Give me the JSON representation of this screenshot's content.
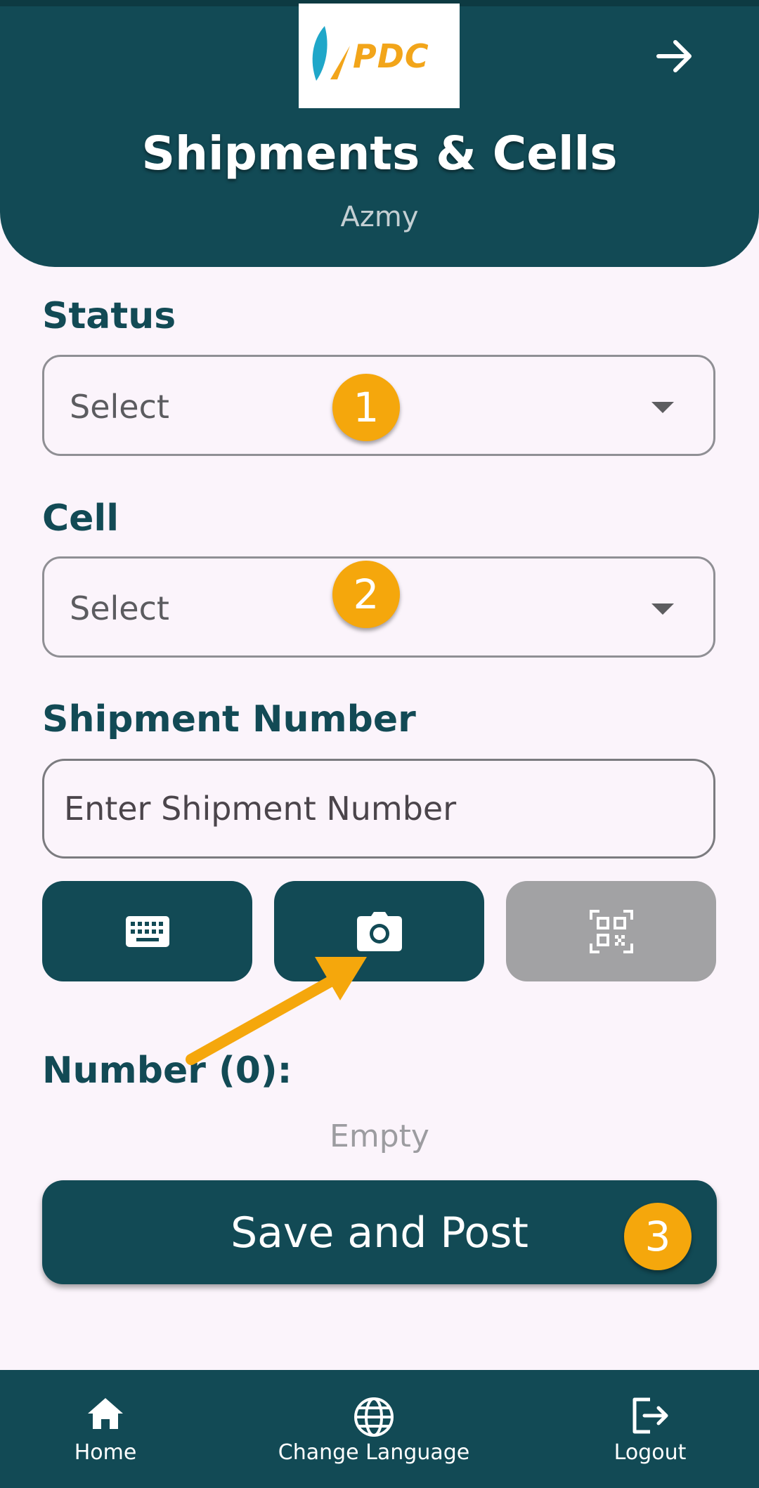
{
  "header": {
    "logo_text": "PDC",
    "title": "Shipments & Cells",
    "subtitle": "Azmy",
    "forward_icon": "arrow-right-icon"
  },
  "form": {
    "status_label": "Status",
    "status_value": "Select",
    "cell_label": "Cell",
    "cell_value": "Select",
    "shipment_label": "Shipment Number",
    "shipment_placeholder": "Enter Shipment Number",
    "shipment_value": ""
  },
  "tools": [
    {
      "icon": "keyboard-icon",
      "enabled": true
    },
    {
      "icon": "camera-icon",
      "enabled": true
    },
    {
      "icon": "qr-code-icon",
      "enabled": false
    }
  ],
  "numbers": {
    "label": "Number (0):",
    "empty_text": "Empty"
  },
  "save_button": {
    "label": "Save and Post"
  },
  "annotations": {
    "badge1": "1",
    "badge2": "2",
    "badge3": "3"
  },
  "bottom_nav": {
    "items": [
      {
        "label": "Home",
        "icon": "home-icon"
      },
      {
        "label": "Change Language",
        "icon": "globe-icon"
      },
      {
        "label": "Logout",
        "icon": "logout-icon"
      }
    ]
  },
  "colors": {
    "primary": "#124a55",
    "background": "#fbf4fb",
    "accent": "#f5a70c",
    "disabled": "#a2a2a4"
  }
}
